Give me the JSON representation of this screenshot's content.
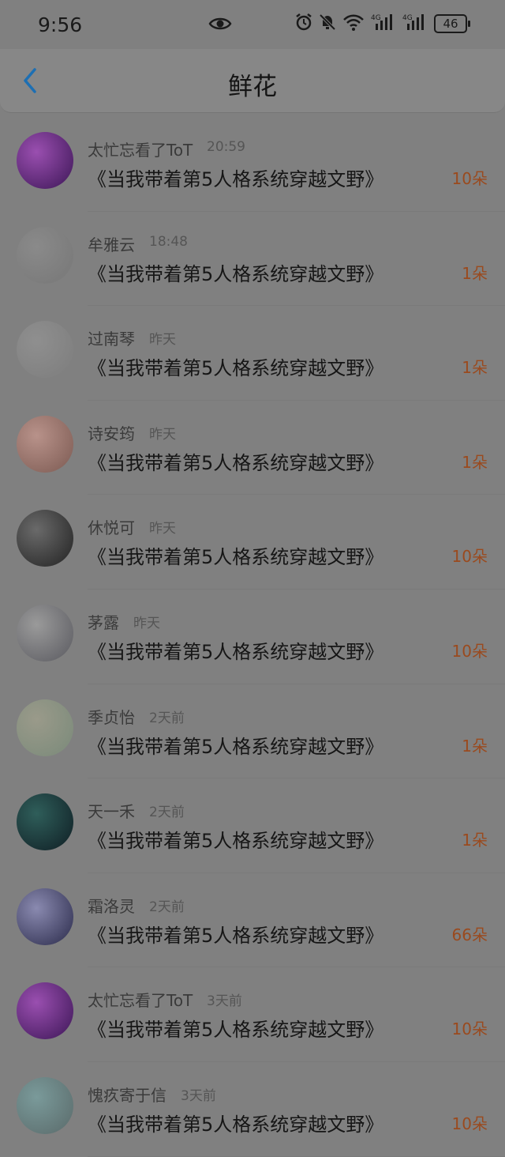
{
  "status_bar": {
    "time": "9:56",
    "battery": "46",
    "icons": [
      "eye-icon",
      "alarm-icon",
      "mute-icon",
      "wifi-icon",
      "signal-4g-icon",
      "signal-4g-icon",
      "battery-icon"
    ]
  },
  "header": {
    "title": "鲜花",
    "back_icon": "back-chevron-icon"
  },
  "colors": {
    "accent": "#9a4a1e",
    "background": "#808080"
  },
  "items": [
    {
      "name": "太忙忘看了ToT",
      "time": "20:59",
      "book": "《当我带着第5人格系统穿越文野》",
      "count": "10朵",
      "avatar_colors": [
        "#9a4fb0",
        "#3c1656"
      ]
    },
    {
      "name": "牟雅云",
      "time": "18:48",
      "book": "《当我带着第5人格系统穿越文野》",
      "count": "1朵",
      "avatar_colors": [
        "#8a8a8a",
        "#777777"
      ]
    },
    {
      "name": "过南琴",
      "time": "昨天",
      "book": "《当我带着第5人格系统穿越文野》",
      "count": "1朵",
      "avatar_colors": [
        "#8f8f8f",
        "#7d7d7d"
      ]
    },
    {
      "name": "诗安筠",
      "time": "昨天",
      "book": "《当我带着第5人格系统穿越文野》",
      "count": "1朵",
      "avatar_colors": [
        "#b8928a",
        "#7c5a52"
      ]
    },
    {
      "name": "休悦可",
      "time": "昨天",
      "book": "《当我带着第5人格系统穿越文野》",
      "count": "10朵",
      "avatar_colors": [
        "#6a6a6a",
        "#222222"
      ]
    },
    {
      "name": "茅露",
      "time": "昨天",
      "book": "《当我带着第5人格系统穿越文野》",
      "count": "10朵",
      "avatar_colors": [
        "#9a9a9a",
        "#5a5a60"
      ]
    },
    {
      "name": "季贞怡",
      "time": "2天前",
      "book": "《当我带着第5人格系统穿越文野》",
      "count": "1朵",
      "avatar_colors": [
        "#9a9a8a",
        "#7a8a7a"
      ]
    },
    {
      "name": "天一禾",
      "time": "2天前",
      "book": "《当我带着第5人格系统穿越文野》",
      "count": "1朵",
      "avatar_colors": [
        "#2f5e5a",
        "#0f1e24"
      ]
    },
    {
      "name": "霜洛灵",
      "time": "2天前",
      "book": "《当我带着第5人格系统穿越文野》",
      "count": "66朵",
      "avatar_colors": [
        "#8a8ab0",
        "#2a2a4a"
      ]
    },
    {
      "name": "太忙忘看了ToT",
      "time": "3天前",
      "book": "《当我带着第5人格系统穿越文野》",
      "count": "10朵",
      "avatar_colors": [
        "#9a4fb0",
        "#3c1656"
      ]
    },
    {
      "name": "愧疚寄于信",
      "time": "3天前",
      "book": "《当我带着第5人格系统穿越文野》",
      "count": "10朵",
      "avatar_colors": [
        "#7a9a9a",
        "#5a6a6a"
      ]
    }
  ]
}
